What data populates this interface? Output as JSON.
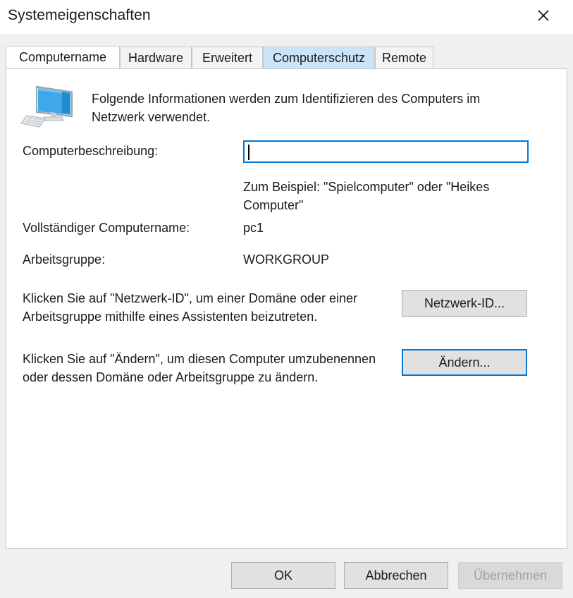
{
  "window": {
    "title": "Systemeigenschaften",
    "close_icon": "close-icon"
  },
  "tabs": [
    {
      "label": "Computername",
      "state": "selected"
    },
    {
      "label": "Hardware",
      "state": "normal"
    },
    {
      "label": "Erweitert",
      "state": "normal"
    },
    {
      "label": "Computerschutz",
      "state": "hovered"
    },
    {
      "label": "Remote",
      "state": "normal"
    }
  ],
  "content": {
    "icon": "computer-monitor-icon",
    "intro": "Folgende Informationen werden zum Identifizieren des Computers im Netzwerk verwendet.",
    "description_label": "Computerbeschreibung:",
    "description_value": "",
    "description_placeholder": "",
    "description_hint": "Zum Beispiel: \"Spielcomputer\" oder \"Heikes Computer\"",
    "full_name_label": "Vollständiger Computername:",
    "full_name_value": "pc1",
    "workgroup_label": "Arbeitsgruppe:",
    "workgroup_value": "WORKGROUP",
    "network_id_paragraph": "Klicken Sie auf \"Netzwerk-ID\", um einer Domäne oder einer Arbeitsgruppe mithilfe eines Assistenten beizutreten.",
    "change_paragraph": "Klicken Sie auf \"Ändern\", um diesen Computer umzubenennen oder dessen Domäne oder Arbeitsgruppe zu ändern.",
    "network_id_button": "Netzwerk-ID...",
    "change_button": "Ändern..."
  },
  "footer": {
    "ok": "OK",
    "cancel": "Abbrechen",
    "apply": "Übernehmen",
    "apply_enabled": false
  },
  "colors": {
    "accent": "#0078d7",
    "tab_hover": "#cce4f7",
    "dialog_bg": "#f0f0f0",
    "panel_bg": "#ffffff",
    "button_face": "#e1e1e1",
    "text": "#1b1b1b",
    "disabled_text": "#a0a0a0"
  }
}
